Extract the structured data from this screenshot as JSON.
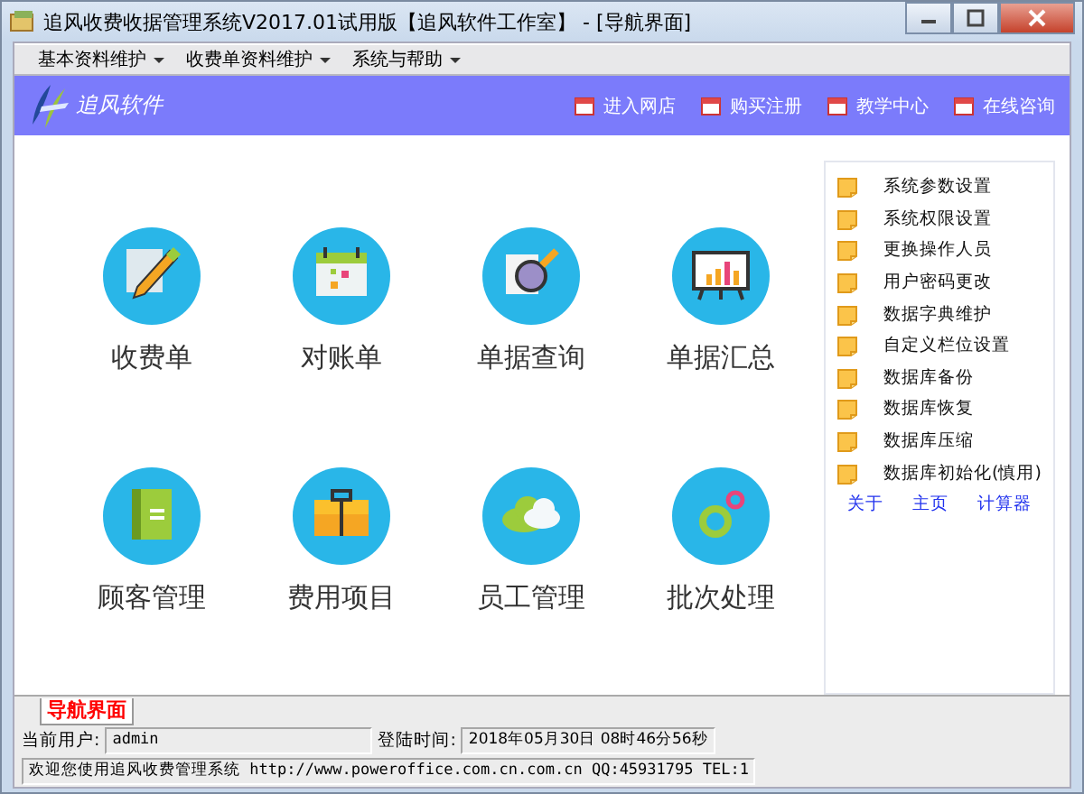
{
  "window": {
    "title": "追风收费收据管理系统V2017.01试用版【追风软件工作室】 - [导航界面]"
  },
  "menu": [
    {
      "label": "基本资料维护"
    },
    {
      "label": "收费单资料维护"
    },
    {
      "label": "系统与帮助"
    }
  ],
  "header": {
    "logo_text": "追风软件",
    "links": [
      {
        "label": "进入网店"
      },
      {
        "label": "购买注册"
      },
      {
        "label": "教学中心"
      },
      {
        "label": "在线咨询"
      }
    ]
  },
  "tiles": [
    {
      "label": "收费单"
    },
    {
      "label": "对账单"
    },
    {
      "label": "单据查询"
    },
    {
      "label": "单据汇总"
    },
    {
      "label": "顾客管理"
    },
    {
      "label": "费用项目"
    },
    {
      "label": "员工管理"
    },
    {
      "label": "批次处理"
    }
  ],
  "side_panel": {
    "items": [
      {
        "label": "系统参数设置"
      },
      {
        "label": "系统权限设置"
      },
      {
        "label": "更换操作人员"
      },
      {
        "label": "用户密码更改"
      },
      {
        "label": "数据字典维护"
      },
      {
        "label": "自定义栏位设置"
      },
      {
        "label": "数据库备份"
      },
      {
        "label": "数据库恢复"
      },
      {
        "label": "数据库压缩"
      },
      {
        "label": "数据库初始化(慎用)"
      }
    ],
    "links": [
      {
        "label": "关于"
      },
      {
        "label": "主页"
      },
      {
        "label": "计算器"
      }
    ]
  },
  "tabs": [
    {
      "label": "导航界面",
      "selected": true
    }
  ],
  "status_bar": {
    "user_label": "当前用户:",
    "user": "admin",
    "login_label": "登陆时间:",
    "login_time": "2018年05月30日 08时46分56秒",
    "message": "欢迎您使用追风收费管理系统 http://www.poweroffice.com.cn.com.cn QQ:45931795 TEL:1"
  }
}
